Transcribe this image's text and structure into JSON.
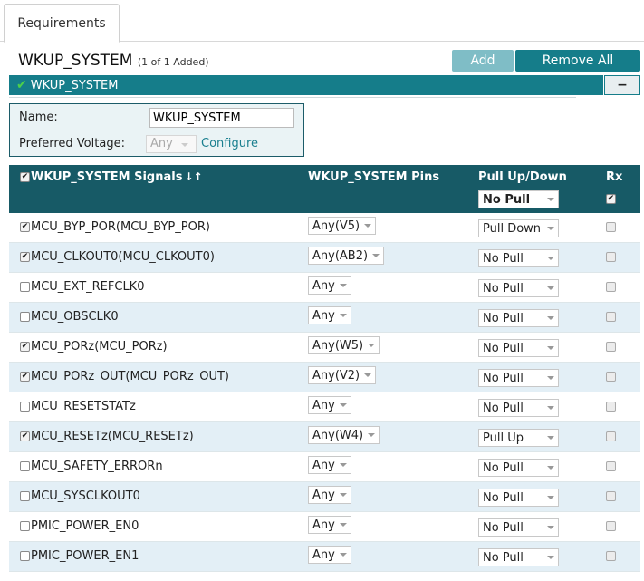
{
  "tab": {
    "label": "Requirements"
  },
  "module": {
    "title": "WKUP_SYSTEM",
    "subtitle": "(1 of 1 Added)",
    "add_label": "Add",
    "remove_all_label": "Remove All"
  },
  "accordion": {
    "title": "WKUP_SYSTEM",
    "collapse_label": "−"
  },
  "props": {
    "name_label": "Name:",
    "name_value": "WKUP_SYSTEM",
    "voltage_label": "Preferred Voltage:",
    "voltage_value": "Any",
    "configure_label": "Configure"
  },
  "table": {
    "col_signals": "WKUP_SYSTEM Signals",
    "sort_icon": "↓↑",
    "col_pins": "WKUP_SYSTEM Pins",
    "col_pull": "Pull Up/Down",
    "col_rx": "Rx",
    "header_pull_value": "No Pull",
    "rows": [
      {
        "signal": "MCU_BYP_POR(MCU_BYP_POR)",
        "pin": "Any(V5)",
        "pull": "Pull Down",
        "checked": true
      },
      {
        "signal": "MCU_CLKOUT0(MCU_CLKOUT0)",
        "pin": "Any(AB2)",
        "pull": "No Pull",
        "checked": true
      },
      {
        "signal": "MCU_EXT_REFCLK0",
        "pin": "Any",
        "pull": "No Pull",
        "checked": false
      },
      {
        "signal": "MCU_OBSCLK0",
        "pin": "Any",
        "pull": "No Pull",
        "checked": false
      },
      {
        "signal": "MCU_PORz(MCU_PORz)",
        "pin": "Any(W5)",
        "pull": "No Pull",
        "checked": true
      },
      {
        "signal": "MCU_PORz_OUT(MCU_PORz_OUT)",
        "pin": "Any(V2)",
        "pull": "No Pull",
        "checked": true
      },
      {
        "signal": "MCU_RESETSTATz",
        "pin": "Any",
        "pull": "No Pull",
        "checked": false
      },
      {
        "signal": "MCU_RESETz(MCU_RESETz)",
        "pin": "Any(W4)",
        "pull": "Pull Up",
        "checked": true
      },
      {
        "signal": "MCU_SAFETY_ERRORn",
        "pin": "Any",
        "pull": "No Pull",
        "checked": false
      },
      {
        "signal": "MCU_SYSCLKOUT0",
        "pin": "Any",
        "pull": "No Pull",
        "checked": false
      },
      {
        "signal": "PMIC_POWER_EN0",
        "pin": "Any",
        "pull": "No Pull",
        "checked": false
      },
      {
        "signal": "PMIC_POWER_EN1",
        "pin": "Any",
        "pull": "No Pull",
        "checked": false
      }
    ]
  },
  "colors": {
    "accent": "#157d8a",
    "header_bg": "#175a66",
    "row_alt": "#e3eff6",
    "add_btn": "#7fbdc6"
  }
}
